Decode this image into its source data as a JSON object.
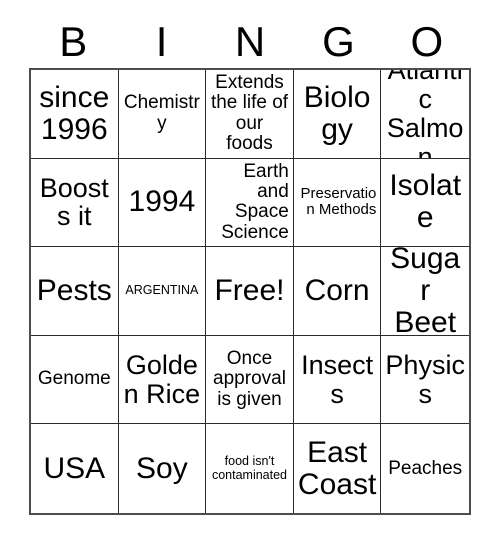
{
  "card": {
    "title_letters": [
      "B",
      "I",
      "N",
      "G",
      "O"
    ],
    "columns": 5,
    "rows": 5,
    "background_color": "#ffffff",
    "text_color": "#000000",
    "border_color": "#2b2b2b",
    "free_space": "Free!",
    "cells": [
      [
        {
          "text": "since 1996",
          "size": "xl",
          "align": "center"
        },
        {
          "text": "Chemistry",
          "size": "md",
          "align": "center"
        },
        {
          "text": "Extends the life of our foods",
          "size": "md",
          "align": "center"
        },
        {
          "text": "Biology",
          "size": "xl",
          "align": "center"
        },
        {
          "text": "Atlantic Salmon",
          "size": "lg",
          "align": "center"
        }
      ],
      [
        {
          "text": "Boosts it",
          "size": "lg",
          "align": "center"
        },
        {
          "text": "1994",
          "size": "xl",
          "align": "center"
        },
        {
          "text": "Earth and Space Science",
          "size": "md",
          "align": "right"
        },
        {
          "text": "Preservation Methods",
          "size": "sm",
          "align": "right"
        },
        {
          "text": "Isolate",
          "size": "xl",
          "align": "center"
        }
      ],
      [
        {
          "text": "Pests",
          "size": "xl",
          "align": "center"
        },
        {
          "text": "ARGENTINA",
          "size": "xs",
          "align": "center"
        },
        {
          "text": "Free!",
          "size": "xl",
          "align": "center"
        },
        {
          "text": "Corn",
          "size": "xl",
          "align": "center"
        },
        {
          "text": "Sugar Beet",
          "size": "xl",
          "align": "center"
        }
      ],
      [
        {
          "text": "Genome",
          "size": "md",
          "align": "center"
        },
        {
          "text": "Golden Rice",
          "size": "lg",
          "align": "center"
        },
        {
          "text": "Once approval is given",
          "size": "md",
          "align": "center"
        },
        {
          "text": "Insects",
          "size": "lg",
          "align": "center"
        },
        {
          "text": "Physics",
          "size": "lg",
          "align": "center"
        }
      ],
      [
        {
          "text": "USA",
          "size": "xl",
          "align": "center"
        },
        {
          "text": "Soy",
          "size": "xl",
          "align": "center"
        },
        {
          "text": "food isn't contaminated",
          "size": "xs",
          "align": "center"
        },
        {
          "text": "East Coast",
          "size": "xl",
          "align": "center"
        },
        {
          "text": "Peaches",
          "size": "md",
          "align": "center"
        }
      ]
    ]
  }
}
